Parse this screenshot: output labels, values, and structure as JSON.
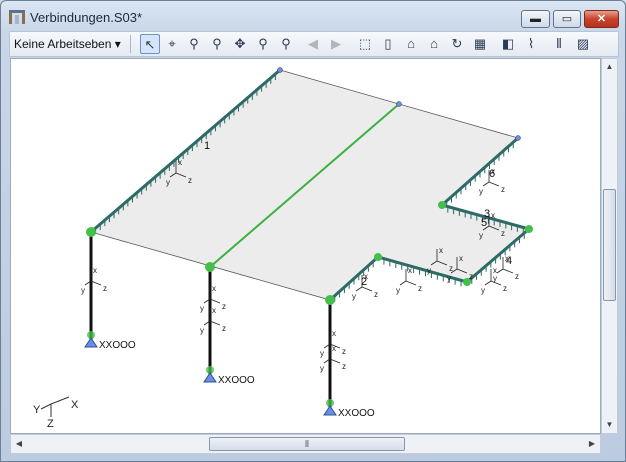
{
  "window": {
    "title": "Verbindungen.S03*"
  },
  "titlebar_buttons": {
    "minimize": "▬",
    "maximize": "▭",
    "close": "✕"
  },
  "toolbar": {
    "workplane_select": "Keine Arbeitseben ▾",
    "buttons": [
      {
        "name": "select-pointer-icon",
        "glyph": "↖",
        "active": true
      },
      {
        "name": "select-region-icon",
        "glyph": "⌖"
      },
      {
        "name": "zoom-all-icon",
        "glyph": "⚲"
      },
      {
        "name": "zoom-in-icon",
        "glyph": "⚲"
      },
      {
        "name": "pan-icon",
        "glyph": "✥"
      },
      {
        "name": "zoom-window-icon",
        "glyph": "⚲"
      },
      {
        "name": "zoom-previous-icon",
        "glyph": "⚲"
      },
      {
        "name": "undo-view-icon",
        "glyph": "◀",
        "disabled": true
      },
      {
        "name": "redo-view-icon",
        "glyph": "▶",
        "disabled": true
      },
      {
        "name": "view-3d-icon",
        "glyph": "⬚"
      },
      {
        "name": "view-front-icon",
        "glyph": "▯"
      },
      {
        "name": "view-house-icon",
        "glyph": "⌂"
      },
      {
        "name": "view-house-red-icon",
        "glyph": "⌂"
      },
      {
        "name": "rotate-view-icon",
        "glyph": "↻"
      },
      {
        "name": "grid-icon",
        "glyph": "▦"
      },
      {
        "name": "render-icon",
        "glyph": "◧"
      },
      {
        "name": "section-icon",
        "glyph": "⌇"
      },
      {
        "name": "hatching-icon",
        "glyph": "⫴"
      },
      {
        "name": "settings-icon",
        "glyph": "▨"
      }
    ]
  },
  "model": {
    "member_labels": [
      "1",
      "2",
      "3",
      "4",
      "5",
      "6"
    ],
    "support_label": "XXOOO",
    "axis_labels": {
      "x": "x",
      "y": "y",
      "z": "z"
    },
    "global_axes": {
      "x": "X",
      "y": "Y",
      "z": "Z"
    }
  },
  "colors": {
    "slab": "#ececec",
    "load_edge": "#2e6b66",
    "interior_line": "#3cb043",
    "node": "#44c04a",
    "support": "#6a8fe0"
  },
  "scroll": {
    "grip": "⦀"
  }
}
